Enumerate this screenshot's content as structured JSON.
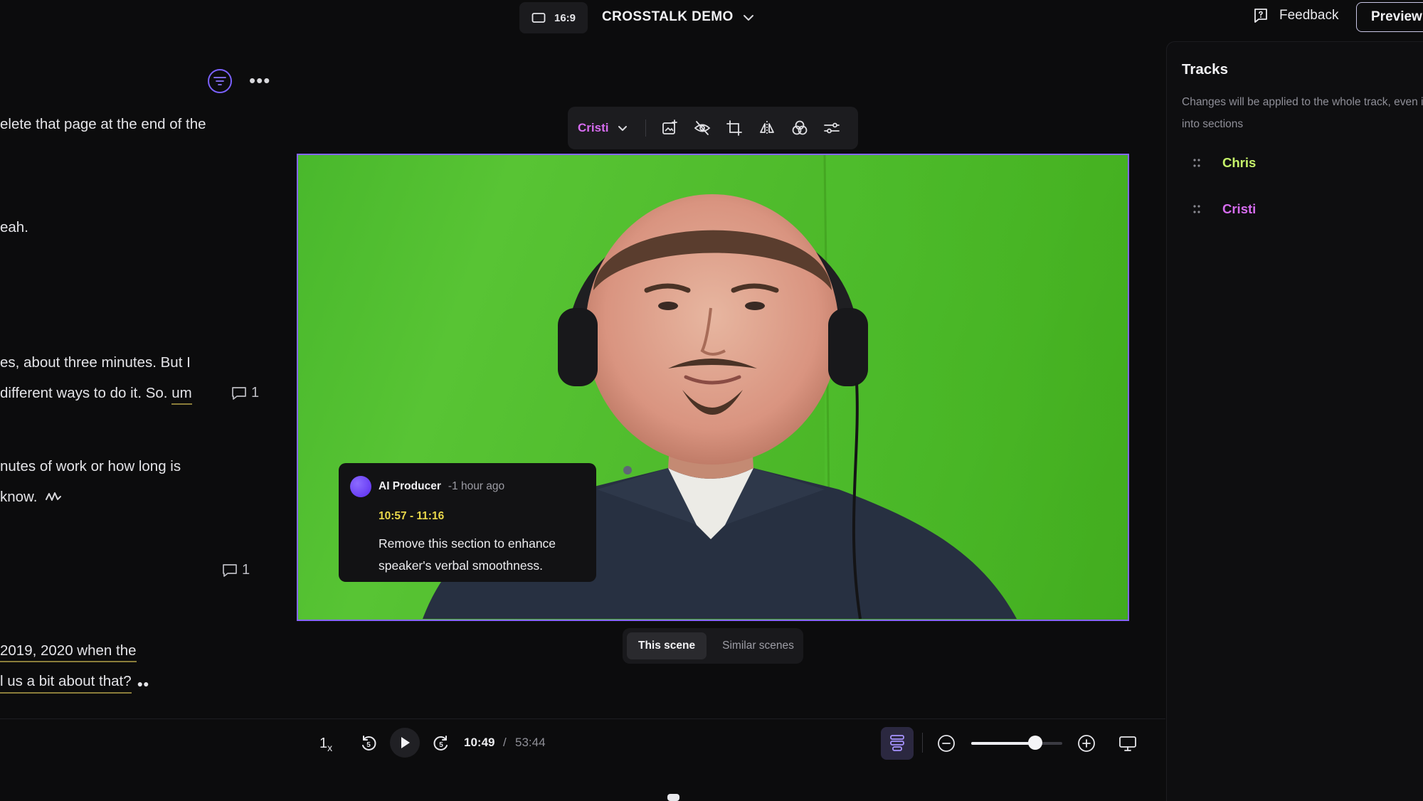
{
  "header": {
    "aspect_ratio": "16:9",
    "project_title": "CROSSTALK DEMO",
    "feedback_label": "Feedback",
    "preview_label": "Preview"
  },
  "transcript": {
    "lines": [
      {
        "text": "elete that page at the end of the"
      },
      {
        "text": "eah."
      },
      {
        "text": "es, about three minutes. But I"
      },
      {
        "pre": "different ways to do it. So. ",
        "underlined": "um"
      },
      {
        "text": "nutes of work or how long is"
      },
      {
        "text": "know."
      },
      {
        "underlined": "2019, 2020 when the"
      },
      {
        "underlined": "l us a bit about that?"
      }
    ],
    "comments": [
      {
        "count": "1"
      },
      {
        "count": "1"
      }
    ]
  },
  "clip_toolbar": {
    "speaker": "Cristi",
    "tools": [
      "add-media-icon",
      "hide-icon",
      "crop-icon",
      "flip-icon",
      "color-icon",
      "adjust-icon"
    ]
  },
  "ai_comment": {
    "author": "AI Producer",
    "time_ago": "-1 hour ago",
    "range": "10:57 - 11:16",
    "message": "Remove this section to enhance speaker's verbal smoothness."
  },
  "scene_toggle": {
    "options": [
      "This scene",
      "Similar scenes"
    ],
    "active": "This scene"
  },
  "playback": {
    "speed": "1",
    "speed_suffix": "x",
    "current_time": "10:49",
    "separator": "/",
    "total_time": "53:44",
    "zoom_level": 0.7
  },
  "tracks": {
    "title": "Tracks",
    "description": "Changes will be applied to the whole track, even if it's split into sections",
    "items": [
      {
        "name": "Chris",
        "color": "#c6f36a"
      },
      {
        "name": "Cristi",
        "color": "#d66cf0"
      }
    ]
  },
  "colors": {
    "accent": "#8467ff",
    "background": "#0c0c0d",
    "highlight_time": "#e8d64a"
  }
}
